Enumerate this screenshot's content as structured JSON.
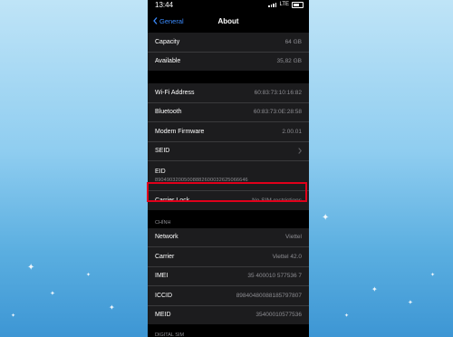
{
  "status_bar": {
    "time": "13:44",
    "network": "LTE"
  },
  "nav": {
    "back_label": "General",
    "title": "About"
  },
  "storage": [
    {
      "label": "Capacity",
      "value": "64 GB"
    },
    {
      "label": "Available",
      "value": "35,82 GB"
    }
  ],
  "hardware": {
    "wifi": {
      "label": "Wi-Fi Address",
      "value": "60:83:73:10:16:82"
    },
    "bluetooth": {
      "label": "Bluetooth",
      "value": "60:83:73:0E:28:58"
    },
    "modem": {
      "label": "Modem Firmware",
      "value": "2.00.01"
    },
    "seid": {
      "label": "SEID"
    },
    "eid": {
      "label": "EID",
      "value": "89049032005008882600032625066646"
    },
    "carrier_lock": {
      "label": "Carrier Lock",
      "value": "No SIM restrictions"
    }
  },
  "sim_section": {
    "header": "CHÍNH",
    "network": {
      "label": "Network",
      "value": "Viettel"
    },
    "carrier": {
      "label": "Carrier",
      "value": "Viettel 42.0"
    },
    "imei": {
      "label": "IMEI",
      "value": "35 400010 577536 7"
    },
    "iccid": {
      "label": "ICCID",
      "value": "8984048008818579780​7"
    },
    "meid": {
      "label": "MEID",
      "value": "35400010577536"
    }
  },
  "digital_sim": {
    "header": "DIGITAL SIM"
  },
  "colors": {
    "accent": "#3b8cff",
    "highlight": "#e0001b"
  }
}
